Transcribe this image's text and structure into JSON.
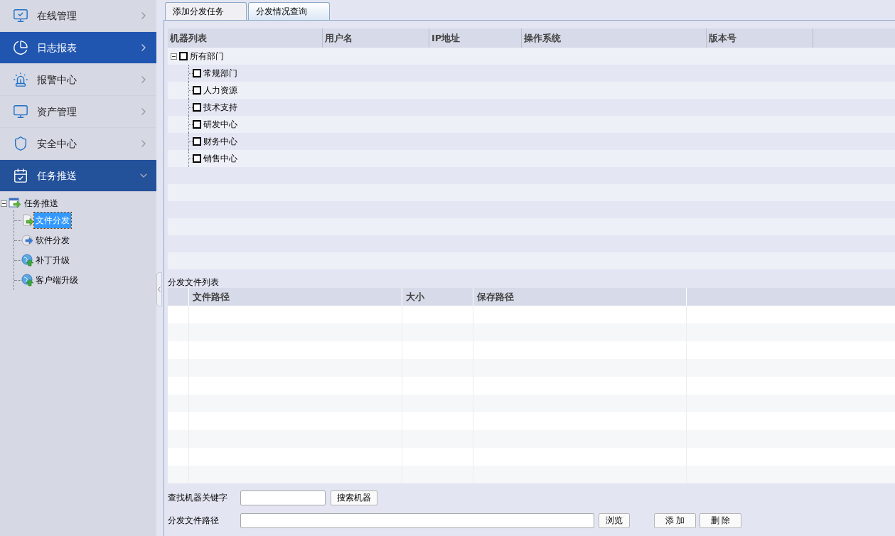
{
  "sidebar": {
    "menu": [
      {
        "label": "在线管理",
        "selected": false,
        "expanded": false
      },
      {
        "label": "日志报表",
        "selected": true,
        "expanded": false
      },
      {
        "label": "报警中心",
        "selected": false,
        "expanded": false
      },
      {
        "label": "资产管理",
        "selected": false,
        "expanded": false
      },
      {
        "label": "安全中心",
        "selected": false,
        "expanded": false
      },
      {
        "label": "任务推送",
        "selected": false,
        "expanded": true
      }
    ],
    "tree": {
      "label": "任务推送",
      "expanded": true,
      "children": [
        {
          "label": "文件分发",
          "selected": true
        },
        {
          "label": "软件分发",
          "selected": false
        },
        {
          "label": "补丁升级",
          "selected": false
        },
        {
          "label": "客户端升级",
          "selected": false
        }
      ]
    }
  },
  "tabs": [
    {
      "label": "添加分发任务",
      "selected": true
    },
    {
      "label": "分发情况查询",
      "selected": false
    }
  ],
  "machine_table": {
    "columns": [
      "机器列表",
      "用户名",
      "IP地址",
      "操作系统",
      "版本号"
    ],
    "tree": {
      "label": "所有部门",
      "checked": false,
      "expanded": true,
      "children": [
        {
          "label": "常规部门",
          "checked": false
        },
        {
          "label": "人力资源",
          "checked": false
        },
        {
          "label": "技术支持",
          "checked": false
        },
        {
          "label": "研发中心",
          "checked": false
        },
        {
          "label": "财务中心",
          "checked": false
        },
        {
          "label": "销售中心",
          "checked": false
        }
      ]
    }
  },
  "file_list": {
    "title": "分发文件列表",
    "columns": [
      "文件路径",
      "大小",
      "保存路径"
    ]
  },
  "form": {
    "search_label": "查找机器关键字",
    "search_button": "搜索机器",
    "path_label": "分发文件路径",
    "browse_button": "浏览",
    "add_button": "添 加",
    "delete_button": "删 除"
  }
}
